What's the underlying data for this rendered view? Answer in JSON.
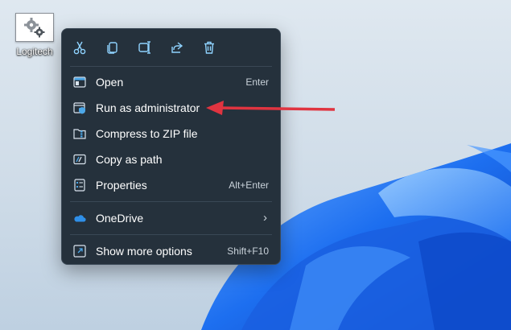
{
  "desktop": {
    "icon_label": "Logitech",
    "icon_name": "gear-icon"
  },
  "context_menu": {
    "toolbar": [
      {
        "name": "cut",
        "icon": "scissors-icon"
      },
      {
        "name": "copy",
        "icon": "copy-icon"
      },
      {
        "name": "rename",
        "icon": "rename-icon"
      },
      {
        "name": "share",
        "icon": "share-icon"
      },
      {
        "name": "delete",
        "icon": "trash-icon"
      }
    ],
    "items": [
      {
        "label": "Open",
        "shortcut": "Enter",
        "icon": "open-icon"
      },
      {
        "label": "Run as administrator",
        "shortcut": "",
        "icon": "shield-icon"
      },
      {
        "label": "Compress to ZIP file",
        "shortcut": "",
        "icon": "zip-folder-icon"
      },
      {
        "label": "Copy as path",
        "shortcut": "",
        "icon": "copy-path-icon"
      },
      {
        "label": "Properties",
        "shortcut": "Alt+Enter",
        "icon": "properties-icon"
      },
      {
        "label": "OneDrive",
        "shortcut": "",
        "icon": "cloud-icon",
        "submenu": true
      },
      {
        "label": "Show more options",
        "shortcut": "Shift+F10",
        "icon": "more-options-icon"
      }
    ]
  },
  "annotation": {
    "type": "arrow",
    "color": "#e03440",
    "points_to": "Run as administrator"
  },
  "colors": {
    "menu_bg": "#25313c",
    "accent": "#4ca7e8",
    "wallpaper_blue": "#1f6fe6"
  }
}
